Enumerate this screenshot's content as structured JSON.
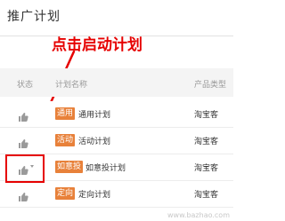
{
  "page": {
    "title": "推广计划"
  },
  "annotation": {
    "text": "点击启动计划",
    "color": "#e60000"
  },
  "table": {
    "headers": {
      "status": "状态",
      "plan_name": "计划名称",
      "product_type": "产品类型"
    },
    "rows": [
      {
        "badge": "通用",
        "name": "通用计划",
        "type": "淘宝客",
        "status_icon": "thumb-icon"
      },
      {
        "badge": "活动",
        "name": "活动计划",
        "type": "淘宝客",
        "status_icon": "thumb-icon"
      },
      {
        "badge": "如意投",
        "name": "如意投计划",
        "type": "淘宝客",
        "status_icon": "thumb-icon",
        "has_dropdown": true
      },
      {
        "badge": "定向",
        "name": "定向计划",
        "type": "淘宝客",
        "status_icon": "thumb-icon"
      }
    ]
  },
  "watermark": "www.bazhao.com",
  "colors": {
    "badge": "#e8813a",
    "annotation": "#e60000",
    "header_bg": "#f4f4f4"
  }
}
